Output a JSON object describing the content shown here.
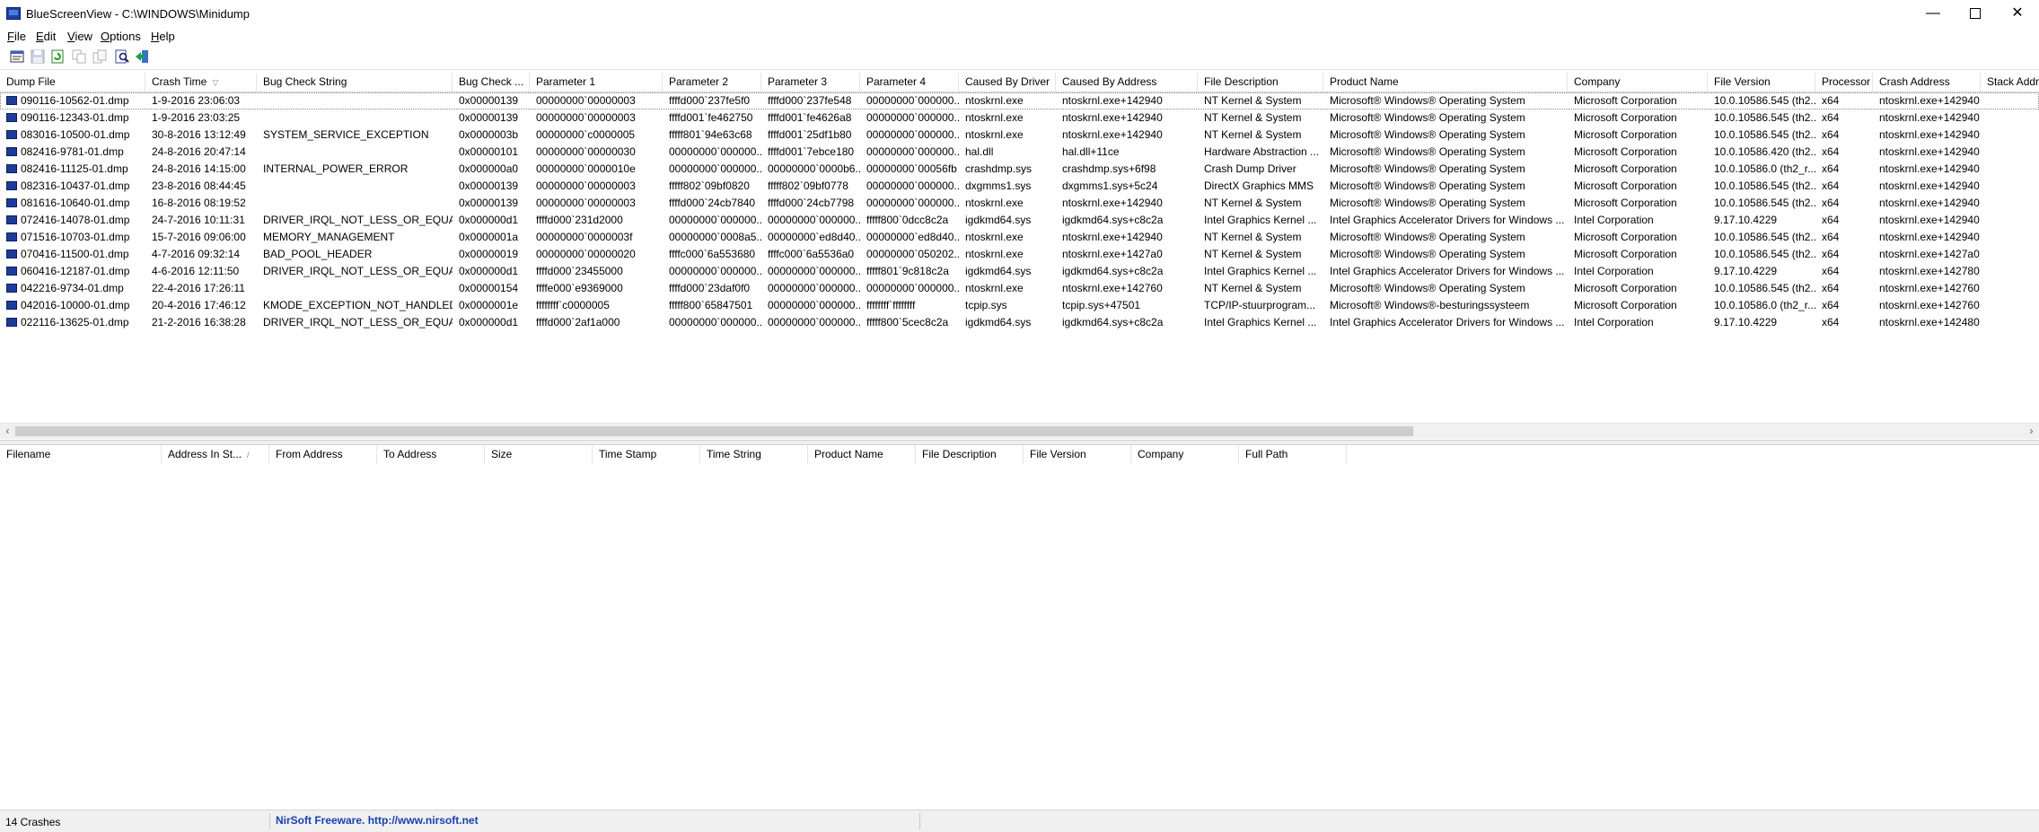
{
  "window": {
    "title": "BlueScreenView  -  C:\\WINDOWS\\Minidump"
  },
  "menu": [
    {
      "accel": "F",
      "rest": "ile"
    },
    {
      "accel": "E",
      "rest": "dit"
    },
    {
      "accel": "V",
      "rest": "iew"
    },
    {
      "accel": "O",
      "rest": "ptions"
    },
    {
      "accel": "H",
      "rest": "elp"
    }
  ],
  "toolbar": {
    "icons": [
      "properties-icon",
      "save-icon",
      "refresh-icon",
      "copy-icon",
      "html-report-icon",
      "find-icon",
      "exit-icon"
    ]
  },
  "columns": [
    "Dump File",
    "Crash Time",
    "Bug Check String",
    "Bug Check ...",
    "Parameter 1",
    "Parameter 2",
    "Parameter 3",
    "Parameter 4",
    "Caused By Driver",
    "Caused By Address",
    "File Description",
    "Product Name",
    "Company",
    "File Version",
    "Processor",
    "Crash Address",
    "Stack Addres"
  ],
  "rows": [
    [
      "090116-10562-01.dmp",
      "1-9-2016 23:06:03",
      "",
      "0x00000139",
      "00000000`00000003",
      "ffffd000`237fe5f0",
      "ffffd000`237fe548",
      "00000000`000000...",
      "ntoskrnl.exe",
      "ntoskrnl.exe+142940",
      "NT Kernel & System",
      "Microsoft® Windows® Operating System",
      "Microsoft Corporation",
      "10.0.10586.545 (th2...",
      "x64",
      "ntoskrnl.exe+142940",
      ""
    ],
    [
      "090116-12343-01.dmp",
      "1-9-2016 23:03:25",
      "",
      "0x00000139",
      "00000000`00000003",
      "ffffd001`fe462750",
      "ffffd001`fe4626a8",
      "00000000`000000...",
      "ntoskrnl.exe",
      "ntoskrnl.exe+142940",
      "NT Kernel & System",
      "Microsoft® Windows® Operating System",
      "Microsoft Corporation",
      "10.0.10586.545 (th2...",
      "x64",
      "ntoskrnl.exe+142940",
      ""
    ],
    [
      "083016-10500-01.dmp",
      "30-8-2016 13:12:49",
      "SYSTEM_SERVICE_EXCEPTION",
      "0x0000003b",
      "00000000`c0000005",
      "fffff801`94e63c68",
      "ffffd001`25df1b80",
      "00000000`000000...",
      "ntoskrnl.exe",
      "ntoskrnl.exe+142940",
      "NT Kernel & System",
      "Microsoft® Windows® Operating System",
      "Microsoft Corporation",
      "10.0.10586.545 (th2...",
      "x64",
      "ntoskrnl.exe+142940",
      ""
    ],
    [
      "082416-9781-01.dmp",
      "24-8-2016 20:47:14",
      "",
      "0x00000101",
      "00000000`00000030",
      "00000000`000000...",
      "ffffd001`7ebce180",
      "00000000`000000...",
      "hal.dll",
      "hal.dll+11ce",
      "Hardware Abstraction ...",
      "Microsoft® Windows® Operating System",
      "Microsoft Corporation",
      "10.0.10586.420 (th2...",
      "x64",
      "ntoskrnl.exe+142940",
      ""
    ],
    [
      "082416-11125-01.dmp",
      "24-8-2016 14:15:00",
      "INTERNAL_POWER_ERROR",
      "0x000000a0",
      "00000000`0000010e",
      "00000000`000000...",
      "00000000`0000b6...",
      "00000000`00056fb",
      "crashdmp.sys",
      "crashdmp.sys+6f98",
      "Crash Dump Driver",
      "Microsoft® Windows® Operating System",
      "Microsoft Corporation",
      "10.0.10586.0 (th2_r...",
      "x64",
      "ntoskrnl.exe+142940",
      ""
    ],
    [
      "082316-10437-01.dmp",
      "23-8-2016 08:44:45",
      "",
      "0x00000139",
      "00000000`00000003",
      "fffff802`09bf0820",
      "fffff802`09bf0778",
      "00000000`000000...",
      "dxgmms1.sys",
      "dxgmms1.sys+5c24",
      "DirectX Graphics MMS",
      "Microsoft® Windows® Operating System",
      "Microsoft Corporation",
      "10.0.10586.545 (th2...",
      "x64",
      "ntoskrnl.exe+142940",
      ""
    ],
    [
      "081616-10640-01.dmp",
      "16-8-2016 08:19:52",
      "",
      "0x00000139",
      "00000000`00000003",
      "ffffd000`24cb7840",
      "ffffd000`24cb7798",
      "00000000`000000...",
      "ntoskrnl.exe",
      "ntoskrnl.exe+142940",
      "NT Kernel & System",
      "Microsoft® Windows® Operating System",
      "Microsoft Corporation",
      "10.0.10586.545 (th2...",
      "x64",
      "ntoskrnl.exe+142940",
      ""
    ],
    [
      "072416-14078-01.dmp",
      "24-7-2016 10:11:31",
      "DRIVER_IRQL_NOT_LESS_OR_EQUAL",
      "0x000000d1",
      "ffffd000`231d2000",
      "00000000`000000...",
      "00000000`000000...",
      "fffff800`0dcc8c2a",
      "igdkmd64.sys",
      "igdkmd64.sys+c8c2a",
      "Intel Graphics Kernel ...",
      "Intel Graphics Accelerator Drivers for Windows ...",
      "Intel Corporation",
      "9.17.10.4229",
      "x64",
      "ntoskrnl.exe+142940",
      ""
    ],
    [
      "071516-10703-01.dmp",
      "15-7-2016 09:06:00",
      "MEMORY_MANAGEMENT",
      "0x0000001a",
      "00000000`0000003f",
      "00000000`0008a5...",
      "00000000`ed8d40...",
      "00000000`ed8d40...",
      "ntoskrnl.exe",
      "ntoskrnl.exe+142940",
      "NT Kernel & System",
      "Microsoft® Windows® Operating System",
      "Microsoft Corporation",
      "10.0.10586.545 (th2...",
      "x64",
      "ntoskrnl.exe+142940",
      ""
    ],
    [
      "070416-11500-01.dmp",
      "4-7-2016 09:32:14",
      "BAD_POOL_HEADER",
      "0x00000019",
      "00000000`00000020",
      "ffffc000`6a553680",
      "ffffc000`6a5536a0",
      "00000000`050202...",
      "ntoskrnl.exe",
      "ntoskrnl.exe+1427a0",
      "NT Kernel & System",
      "Microsoft® Windows® Operating System",
      "Microsoft Corporation",
      "10.0.10586.545 (th2...",
      "x64",
      "ntoskrnl.exe+1427a0",
      ""
    ],
    [
      "060416-12187-01.dmp",
      "4-6-2016 12:11:50",
      "DRIVER_IRQL_NOT_LESS_OR_EQUAL",
      "0x000000d1",
      "ffffd000`23455000",
      "00000000`000000...",
      "00000000`000000...",
      "fffff801`9c818c2a",
      "igdkmd64.sys",
      "igdkmd64.sys+c8c2a",
      "Intel Graphics Kernel ...",
      "Intel Graphics Accelerator Drivers for Windows ...",
      "Intel Corporation",
      "9.17.10.4229",
      "x64",
      "ntoskrnl.exe+142780",
      ""
    ],
    [
      "042216-9734-01.dmp",
      "22-4-2016 17:26:11",
      "",
      "0x00000154",
      "ffffe000`e9369000",
      "ffffd000`23daf0f0",
      "00000000`000000...",
      "00000000`000000...",
      "ntoskrnl.exe",
      "ntoskrnl.exe+142760",
      "NT Kernel & System",
      "Microsoft® Windows® Operating System",
      "Microsoft Corporation",
      "10.0.10586.545 (th2...",
      "x64",
      "ntoskrnl.exe+142760",
      ""
    ],
    [
      "042016-10000-01.dmp",
      "20-4-2016 17:46:12",
      "KMODE_EXCEPTION_NOT_HANDLED",
      "0x0000001e",
      "ffffffff`c0000005",
      "fffff800`65847501",
      "00000000`000000...",
      "ffffffff`ffffffff",
      "tcpip.sys",
      "tcpip.sys+47501",
      "TCP/IP-stuurprogram...",
      "Microsoft® Windows®-besturingssysteem",
      "Microsoft Corporation",
      "10.0.10586.0 (th2_r...",
      "x64",
      "ntoskrnl.exe+142760",
      ""
    ],
    [
      "022116-13625-01.dmp",
      "21-2-2016 16:38:28",
      "DRIVER_IRQL_NOT_LESS_OR_EQUAL",
      "0x000000d1",
      "ffffd000`2af1a000",
      "00000000`000000...",
      "00000000`000000...",
      "fffff800`5cec8c2a",
      "igdkmd64.sys",
      "igdkmd64.sys+c8c2a",
      "Intel Graphics Kernel ...",
      "Intel Graphics Accelerator Drivers for Windows ...",
      "Intel Corporation",
      "9.17.10.4229",
      "x64",
      "ntoskrnl.exe+142480",
      ""
    ]
  ],
  "lower_columns": [
    "Filename",
    "Address In St...",
    "From Address",
    "To Address",
    "Size",
    "Time Stamp",
    "Time String",
    "Product Name",
    "File Description",
    "File Version",
    "Company",
    "Full Path"
  ],
  "status": {
    "count": "14 Crashes",
    "link": "NirSoft Freeware.  http://www.nirsoft.net"
  },
  "colors": {
    "link": "#1b3fb0",
    "icon_blue": "#1d3c9a"
  }
}
